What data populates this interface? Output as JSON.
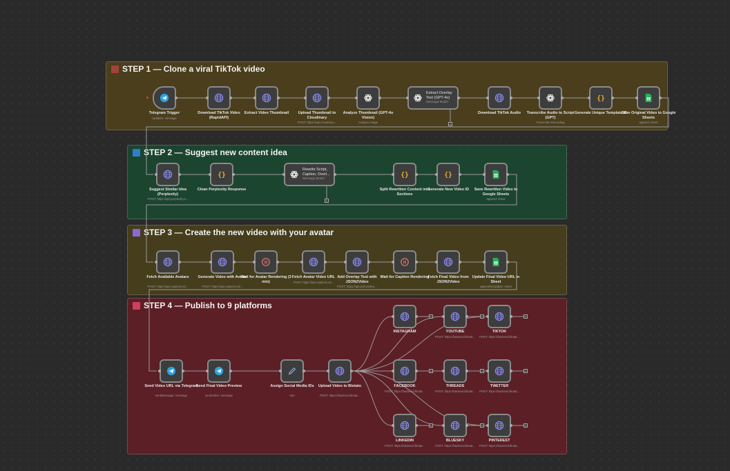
{
  "colors": {
    "step1_bg": "#4a3e1c",
    "step2_bg": "#1c4530",
    "step3_bg": "#463d1d",
    "step4_bg": "#5c1f26",
    "step1_sq": "#a3423c",
    "step2_sq": "#2f7fc8",
    "step3_sq": "#8a6ad6",
    "step4_sq": "#d0405a",
    "globe": "#8a8af0",
    "telegram": "#2aa3e0",
    "sheets": "#22b25a",
    "code": "#f0b030",
    "wait": "#e07a60"
  },
  "stickies": [
    {
      "id": "s1",
      "title": "STEP 1 — Clone a viral TikTok video",
      "bg": "#4a3e1c",
      "sq": "#a3423c"
    },
    {
      "id": "s2",
      "title": "STEP 2 — Suggest new content idea",
      "bg": "#1c4530",
      "sq": "#2f7fc8"
    },
    {
      "id": "s3",
      "title": "STEP 3 — Create the new video with your avatar",
      "bg": "#463d1d",
      "sq": "#8a6ad6"
    },
    {
      "id": "s4",
      "title": "STEP 4 — Publish to 9 platforms",
      "bg": "#5c1f26",
      "sq": "#d0405a"
    }
  ],
  "nodes": [
    {
      "id": "n1",
      "icon": "telegram",
      "label": "Telegram Trigger",
      "sub": "Updates: message",
      "trigger": true
    },
    {
      "id": "n2",
      "icon": "globe",
      "label": "Download TikTok Video (RapidAPI)",
      "sub": ""
    },
    {
      "id": "n3",
      "icon": "globe",
      "label": "Extract Video Thumbnail",
      "sub": ""
    },
    {
      "id": "n4",
      "icon": "globe",
      "label": "Upload Thumbnail to Cloudinary",
      "sub": "POST: https://api.cloudinary..."
    },
    {
      "id": "n5",
      "icon": "openai",
      "label": "Analyze Thumbnail (GPT-4o Vision)",
      "sub": "Analyze image"
    },
    {
      "id": "n6",
      "icon": "openai",
      "label": "Extract Overlay Text (GPT-4o)",
      "sub": "Message Model",
      "wide": true
    },
    {
      "id": "n7",
      "icon": "globe",
      "label": "Download TikTok Audio",
      "sub": ""
    },
    {
      "id": "n8",
      "icon": "openai",
      "label": "Transcribe Audio to Script (GPT)",
      "sub": "Transcribe Recording"
    },
    {
      "id": "n9",
      "icon": "code",
      "label": "Generate Unique Template ID",
      "sub": ""
    },
    {
      "id": "n10",
      "icon": "sheets",
      "label": "Save Original Video to Google Sheets",
      "sub": "append: sheet"
    },
    {
      "id": "n11",
      "icon": "globe",
      "label": "Suggest Similar Idea (Perplexity)",
      "sub": "POST: https://api.perplexity.a..."
    },
    {
      "id": "n12",
      "icon": "code",
      "label": "Clean Perplexity Response",
      "sub": ""
    },
    {
      "id": "n13",
      "icon": "openai",
      "label": "Rewrite Script, Caption, Overl...",
      "sub": "Message Model",
      "wide": true
    },
    {
      "id": "n14",
      "icon": "code",
      "label": "Split Rewritten Content into Sections",
      "sub": ""
    },
    {
      "id": "n15",
      "icon": "code",
      "label": "Generate New Video ID",
      "sub": ""
    },
    {
      "id": "n16",
      "icon": "sheets",
      "label": "Save Rewritten Video to Google Sheets",
      "sub": "append: sheet"
    },
    {
      "id": "n17",
      "icon": "globe",
      "label": "Fetch Available Avatars",
      "sub": "POST: https://api.captions.ai/..."
    },
    {
      "id": "n18",
      "icon": "globe",
      "label": "Generate Video with Avatar",
      "sub": "POST: https://api.captions.ai/..."
    },
    {
      "id": "n19",
      "icon": "wait",
      "label": "Wait for Avatar Rendering (3 min)",
      "sub": ""
    },
    {
      "id": "n20",
      "icon": "globe",
      "label": "Fetch Avatar Video URL",
      "sub": "POST: https://api.captions.ai/..."
    },
    {
      "id": "n21",
      "icon": "globe",
      "label": "Add Overlay Text with JSON2Video",
      "sub": "POST: https://api.json2video..."
    },
    {
      "id": "n22",
      "icon": "wait",
      "label": "Wait for Caption Rendering",
      "sub": ""
    },
    {
      "id": "n23",
      "icon": "globe",
      "label": "Fetch Final Video from JSON2Video",
      "sub": ""
    },
    {
      "id": "n24",
      "icon": "sheets",
      "label": "Update Final Video URL in Sheet",
      "sub": "appendOrUpdate: sheet"
    },
    {
      "id": "n25",
      "icon": "telegram",
      "label": "Send Video URL via Telegram",
      "sub": "sendMessage: message"
    },
    {
      "id": "n26",
      "icon": "telegram",
      "label": "Send Final Video Preview",
      "sub": "sendVideo: message"
    },
    {
      "id": "n27",
      "icon": "pen",
      "label": "Assign Social Media IDs",
      "sub": "raw"
    },
    {
      "id": "n28",
      "icon": "globe",
      "label": "Upload Video to Blotato",
      "sub": "POST: https://backend.blotat..."
    },
    {
      "id": "n29",
      "icon": "globe",
      "label": "INSTAGRAM",
      "sub": ""
    },
    {
      "id": "n30",
      "icon": "globe",
      "label": "YOUTUBE",
      "sub": "POST: https://backend.blotat..."
    },
    {
      "id": "n31",
      "icon": "globe",
      "label": "TIKTOK",
      "sub": "POST: https://backend.blotat..."
    },
    {
      "id": "n32",
      "icon": "globe",
      "label": "FACEBOOK",
      "sub": "POST: https://backend.blotat..."
    },
    {
      "id": "n33",
      "icon": "globe",
      "label": "THREADS",
      "sub": "POST: https://backend.blotat..."
    },
    {
      "id": "n34",
      "icon": "globe",
      "label": "TWETTER",
      "sub": "POST: https://backend.blotat..."
    },
    {
      "id": "n35",
      "icon": "globe",
      "label": "LINKEDIN",
      "sub": "POST: https://backend.blotat..."
    },
    {
      "id": "n36",
      "icon": "globe",
      "label": "BLUESKY",
      "sub": "POST: https://backend.blotat..."
    },
    {
      "id": "n37",
      "icon": "globe",
      "label": "PINTEREST",
      "sub": "POST: https://backend.blotat..."
    }
  ],
  "plus_symbol": "+"
}
